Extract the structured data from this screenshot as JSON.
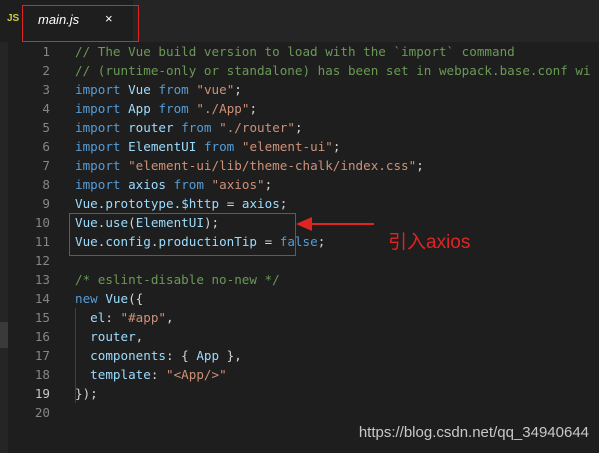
{
  "tab": {
    "icon": "JS",
    "filename": "main.js",
    "close": "×"
  },
  "annotation": "引入axios",
  "watermark": "https://blog.csdn.net/qq_34940644",
  "active_line": 19,
  "lines": [
    {
      "n": "1",
      "tokens": [
        {
          "t": "// The Vue build version to load with the `import` command",
          "c": "cm"
        }
      ]
    },
    {
      "n": "2",
      "tokens": [
        {
          "t": "// (runtime-only or standalone) has been set in webpack.base.conf wi",
          "c": "cm"
        }
      ]
    },
    {
      "n": "3",
      "tokens": [
        {
          "t": "import",
          "c": "kw"
        },
        {
          "t": " ",
          "c": "tk-ws"
        },
        {
          "t": "Vue",
          "c": "id"
        },
        {
          "t": " ",
          "c": "tk-ws"
        },
        {
          "t": "from",
          "c": "kw"
        },
        {
          "t": " ",
          "c": "tk-ws"
        },
        {
          "t": "\"vue\"",
          "c": "str"
        },
        {
          "t": ";",
          "c": "tk-ws"
        }
      ]
    },
    {
      "n": "4",
      "tokens": [
        {
          "t": "import",
          "c": "kw"
        },
        {
          "t": " ",
          "c": "tk-ws"
        },
        {
          "t": "App",
          "c": "id"
        },
        {
          "t": " ",
          "c": "tk-ws"
        },
        {
          "t": "from",
          "c": "kw"
        },
        {
          "t": " ",
          "c": "tk-ws"
        },
        {
          "t": "\"./App\"",
          "c": "str"
        },
        {
          "t": ";",
          "c": "tk-ws"
        }
      ]
    },
    {
      "n": "5",
      "tokens": [
        {
          "t": "import",
          "c": "kw"
        },
        {
          "t": " ",
          "c": "tk-ws"
        },
        {
          "t": "router",
          "c": "id"
        },
        {
          "t": " ",
          "c": "tk-ws"
        },
        {
          "t": "from",
          "c": "kw"
        },
        {
          "t": " ",
          "c": "tk-ws"
        },
        {
          "t": "\"./router\"",
          "c": "str"
        },
        {
          "t": ";",
          "c": "tk-ws"
        }
      ]
    },
    {
      "n": "6",
      "tokens": [
        {
          "t": "import",
          "c": "kw"
        },
        {
          "t": " ",
          "c": "tk-ws"
        },
        {
          "t": "ElementUI",
          "c": "id"
        },
        {
          "t": " ",
          "c": "tk-ws"
        },
        {
          "t": "from",
          "c": "kw"
        },
        {
          "t": " ",
          "c": "tk-ws"
        },
        {
          "t": "\"element-ui\"",
          "c": "str"
        },
        {
          "t": ";",
          "c": "tk-ws"
        }
      ]
    },
    {
      "n": "7",
      "tokens": [
        {
          "t": "import",
          "c": "kw"
        },
        {
          "t": " ",
          "c": "tk-ws"
        },
        {
          "t": "\"element-ui/lib/theme-chalk/index.css\"",
          "c": "str"
        },
        {
          "t": ";",
          "c": "tk-ws"
        }
      ]
    },
    {
      "n": "8",
      "tokens": [
        {
          "t": "import",
          "c": "kw"
        },
        {
          "t": " ",
          "c": "tk-ws"
        },
        {
          "t": "axios",
          "c": "id"
        },
        {
          "t": " ",
          "c": "tk-ws"
        },
        {
          "t": "from",
          "c": "kw"
        },
        {
          "t": " ",
          "c": "tk-ws"
        },
        {
          "t": "\"axios\"",
          "c": "str"
        },
        {
          "t": ";",
          "c": "tk-ws"
        }
      ]
    },
    {
      "n": "9",
      "tokens": [
        {
          "t": "Vue",
          "c": "id"
        },
        {
          "t": ".",
          "c": "tk-ws"
        },
        {
          "t": "prototype",
          "c": "id"
        },
        {
          "t": ".",
          "c": "tk-ws"
        },
        {
          "t": "$http",
          "c": "id"
        },
        {
          "t": " = ",
          "c": "tk-ws"
        },
        {
          "t": "axios",
          "c": "id"
        },
        {
          "t": ";",
          "c": "tk-ws"
        }
      ]
    },
    {
      "n": "10",
      "tokens": [
        {
          "t": "Vue",
          "c": "id"
        },
        {
          "t": ".",
          "c": "tk-ws"
        },
        {
          "t": "use",
          "c": "id"
        },
        {
          "t": "(",
          "c": "tk-ws"
        },
        {
          "t": "ElementUI",
          "c": "id"
        },
        {
          "t": ");",
          "c": "tk-ws"
        }
      ]
    },
    {
      "n": "11",
      "tokens": [
        {
          "t": "Vue",
          "c": "id"
        },
        {
          "t": ".",
          "c": "tk-ws"
        },
        {
          "t": "config",
          "c": "id"
        },
        {
          "t": ".",
          "c": "tk-ws"
        },
        {
          "t": "productionTip",
          "c": "id"
        },
        {
          "t": " = ",
          "c": "tk-ws"
        },
        {
          "t": "false",
          "c": "kw"
        },
        {
          "t": ";",
          "c": "tk-ws"
        }
      ]
    },
    {
      "n": "12",
      "tokens": []
    },
    {
      "n": "13",
      "tokens": [
        {
          "t": "/* eslint-disable no-new */",
          "c": "cm"
        }
      ]
    },
    {
      "n": "14",
      "tokens": [
        {
          "t": "new",
          "c": "kw"
        },
        {
          "t": " ",
          "c": "tk-ws"
        },
        {
          "t": "Vue",
          "c": "id"
        },
        {
          "t": "({",
          "c": "tk-ws"
        }
      ]
    },
    {
      "n": "15",
      "tokens": [
        {
          "t": "  ",
          "c": "tk-ws"
        },
        {
          "t": "el",
          "c": "id"
        },
        {
          "t": ": ",
          "c": "tk-ws"
        },
        {
          "t": "\"#app\"",
          "c": "str"
        },
        {
          "t": ",",
          "c": "tk-ws"
        }
      ]
    },
    {
      "n": "16",
      "tokens": [
        {
          "t": "  ",
          "c": "tk-ws"
        },
        {
          "t": "router",
          "c": "id"
        },
        {
          "t": ",",
          "c": "tk-ws"
        }
      ]
    },
    {
      "n": "17",
      "tokens": [
        {
          "t": "  ",
          "c": "tk-ws"
        },
        {
          "t": "components",
          "c": "id"
        },
        {
          "t": ": { ",
          "c": "tk-ws"
        },
        {
          "t": "App",
          "c": "id"
        },
        {
          "t": " },",
          "c": "tk-ws"
        }
      ]
    },
    {
      "n": "18",
      "tokens": [
        {
          "t": "  ",
          "c": "tk-ws"
        },
        {
          "t": "template",
          "c": "id"
        },
        {
          "t": ": ",
          "c": "tk-ws"
        },
        {
          "t": "\"<App/>\"",
          "c": "str"
        }
      ]
    },
    {
      "n": "19",
      "tokens": [
        {
          "t": "});",
          "c": "tk-ws"
        }
      ]
    },
    {
      "n": "20",
      "tokens": []
    }
  ],
  "colors": {
    "background": "#1e1e1e",
    "keyword": "#569cd6",
    "string": "#ce9178",
    "comment": "#6a9955",
    "identifier": "#9cdcfe",
    "highlight_red": "#e02424"
  }
}
